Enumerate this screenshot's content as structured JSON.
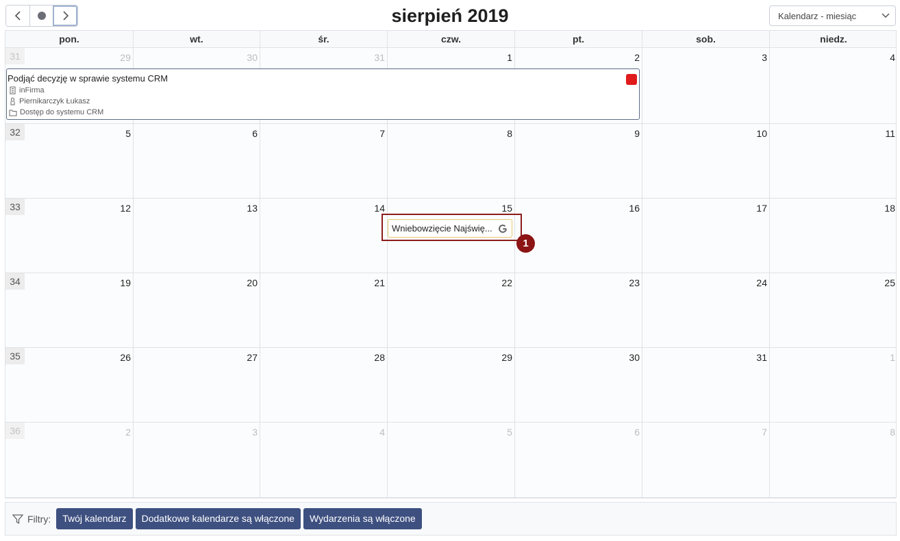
{
  "header": {
    "title": "sierpień 2019",
    "view_select": "Kalendarz - miesiąc"
  },
  "weekdays": [
    "pon.",
    "wt.",
    "śr.",
    "czw.",
    "pt.",
    "sob.",
    "niedz."
  ],
  "weeks": [
    {
      "num": "31",
      "days": [
        "29",
        "30",
        "31",
        "1",
        "2",
        "3",
        "4"
      ],
      "other": [
        true,
        true,
        true,
        false,
        false,
        false,
        false
      ]
    },
    {
      "num": "32",
      "days": [
        "5",
        "6",
        "7",
        "8",
        "9",
        "10",
        "11"
      ],
      "other": [
        false,
        false,
        false,
        false,
        false,
        false,
        false
      ]
    },
    {
      "num": "33",
      "days": [
        "12",
        "13",
        "14",
        "15",
        "16",
        "17",
        "18"
      ],
      "other": [
        false,
        false,
        false,
        false,
        false,
        false,
        false
      ]
    },
    {
      "num": "34",
      "days": [
        "19",
        "20",
        "21",
        "22",
        "23",
        "24",
        "25"
      ],
      "other": [
        false,
        false,
        false,
        false,
        false,
        false,
        false
      ]
    },
    {
      "num": "35",
      "days": [
        "26",
        "27",
        "28",
        "29",
        "30",
        "31",
        "1"
      ],
      "other": [
        false,
        false,
        false,
        false,
        false,
        false,
        true
      ]
    },
    {
      "num": "36",
      "days": [
        "2",
        "3",
        "4",
        "5",
        "6",
        "7",
        "8"
      ],
      "other": [
        true,
        true,
        true,
        true,
        true,
        true,
        true
      ]
    }
  ],
  "event": {
    "title": "Podjąć decyzję w sprawie systemu CRM",
    "company": "inFirma",
    "person": "Piernikarczyk Łukasz",
    "project": "Dostęp do systemu CRM",
    "flag_color": "#e01b1b"
  },
  "google_event": {
    "title": "Wniebowzięcie Najświę...",
    "marker": "1"
  },
  "filters": {
    "label": "Filtry:",
    "buttons": [
      "Twój kalendarz",
      "Dodatkowe kalendarze są włączone",
      "Wydarzenia są włączone"
    ]
  },
  "colors": {
    "accent": "#3e5080",
    "highlight": "#8c1c1c",
    "event_border": "#5b6b84"
  }
}
